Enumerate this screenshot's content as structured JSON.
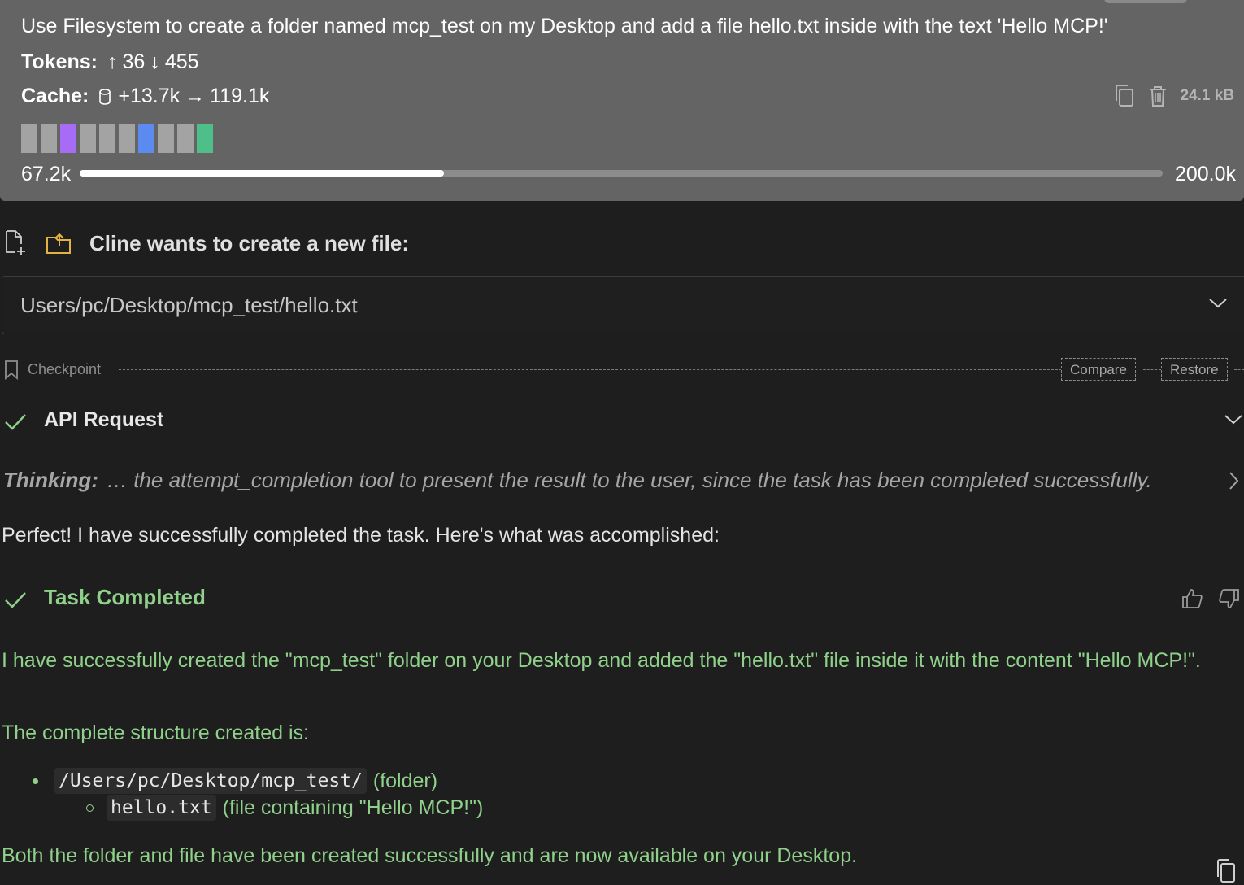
{
  "task": {
    "text": "Use Filesystem to create a folder named mcp_test on my Desktop and add a file hello.txt inside with the text 'Hello MCP!'",
    "tokens_label": "Tokens:",
    "tokens_up": "36",
    "tokens_down": "455",
    "cache_label": "Cache:",
    "cache_write": "+13.7k",
    "cache_read": "119.1k",
    "size": "24.1 kB",
    "context_used": "67.2k",
    "context_max": "200.0k",
    "context_fraction": 0.336,
    "blocks": [
      "#a3a3a3",
      "#a3a3a3",
      "#a66cf5",
      "#a3a3a3",
      "#a3a3a3",
      "#a3a3a3",
      "#5b8af0",
      "#a3a3a3",
      "#a3a3a3",
      "#4fbf8a"
    ]
  },
  "tool": {
    "title": "Cline wants to create a new file:",
    "path": "Users/pc/Desktop/mcp_test/hello.txt"
  },
  "checkpoint": {
    "label": "Checkpoint",
    "compare": "Compare",
    "restore": "Restore"
  },
  "api": {
    "title": "API Request"
  },
  "thinking": {
    "label": "Thinking:",
    "text": "… the attempt_completion tool to present the result to the user, since the task has been completed successfully."
  },
  "message": "Perfect! I have successfully completed the task. Here's what was accomplished:",
  "completion": {
    "title": "Task Completed",
    "para1": "I have successfully created the \"mcp_test\" folder on your Desktop and added the \"hello.txt\" file inside it with the content \"Hello MCP!\".",
    "para2": "The complete structure created is:",
    "item1_code": "/Users/pc/Desktop/mcp_test/",
    "item1_text": "(folder)",
    "item2_code": "hello.txt",
    "item2_text": "(file containing \"Hello MCP!\")",
    "para3": "Both the folder and file have been created successfully and are now available on your Desktop."
  },
  "colors": {
    "accent_green": "#8fd18a",
    "folder_icon": "#e3b341",
    "check": "#8fd18a"
  }
}
